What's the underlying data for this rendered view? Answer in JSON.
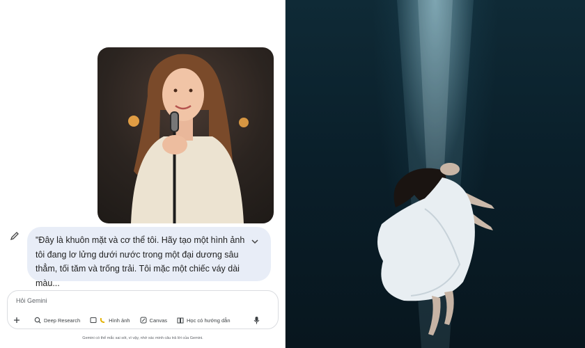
{
  "chat": {
    "prompt_text": "\"Đây là khuôn mặt và cơ thể tôi. Hãy tạo một hình ảnh tôi đang lơ lửng dưới nước trong một đại dương sâu thẳm, tối tăm và trống trải. Tôi mặc một chiếc váy dài màu...",
    "input_placeholder": "Hỏi Gemini",
    "tools": [
      {
        "label": "Deep Research",
        "icon": "deep-research-icon"
      },
      {
        "label": "Hình ảnh",
        "icon": "banana-icon"
      },
      {
        "label": "Canvas",
        "icon": "canvas-icon"
      },
      {
        "label": "Học có hướng dẫn",
        "icon": "book-icon"
      }
    ],
    "footer_note": "Gemini có thể mắc sai sót, vì vậy, nhớ xác minh câu trả lời của Gemini."
  },
  "colors": {
    "bubble": "#e8edf7",
    "ocean_dark": "#08161e",
    "light_beam": "#aadceb"
  }
}
